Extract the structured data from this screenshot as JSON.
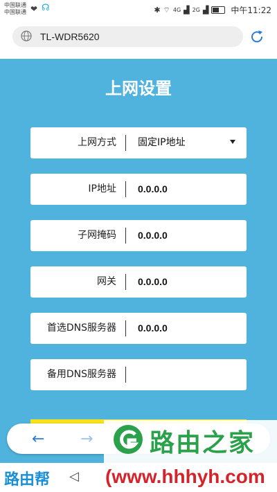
{
  "status_bar": {
    "carrier_line1": "中国联通",
    "carrier_line2": "中国联通",
    "network1": "4G",
    "network2": "2G",
    "time": "中午11:22"
  },
  "address_bar": {
    "url": "TL-WDR5620"
  },
  "page": {
    "title": "上网设置"
  },
  "form": {
    "fields": [
      {
        "label": "上网方式",
        "value": "固定IP地址"
      },
      {
        "label": "IP地址",
        "value": "0.0.0.0"
      },
      {
        "label": "子网掩码",
        "value": "0.0.0.0"
      },
      {
        "label": "网关",
        "value": "0.0.0.0"
      },
      {
        "label": "首选DNS服务器",
        "value": "0.0.0.0"
      },
      {
        "label": "备用DNS服务器",
        "value": ""
      }
    ]
  },
  "watermark": {
    "brand": "路由之家",
    "left_brand": "路由帮",
    "site": "(www.hhhyh.com"
  },
  "colors": {
    "background": "#4fb3dd",
    "accent_blue": "#2c7bd4",
    "button_yellow": "#f7e11a"
  }
}
